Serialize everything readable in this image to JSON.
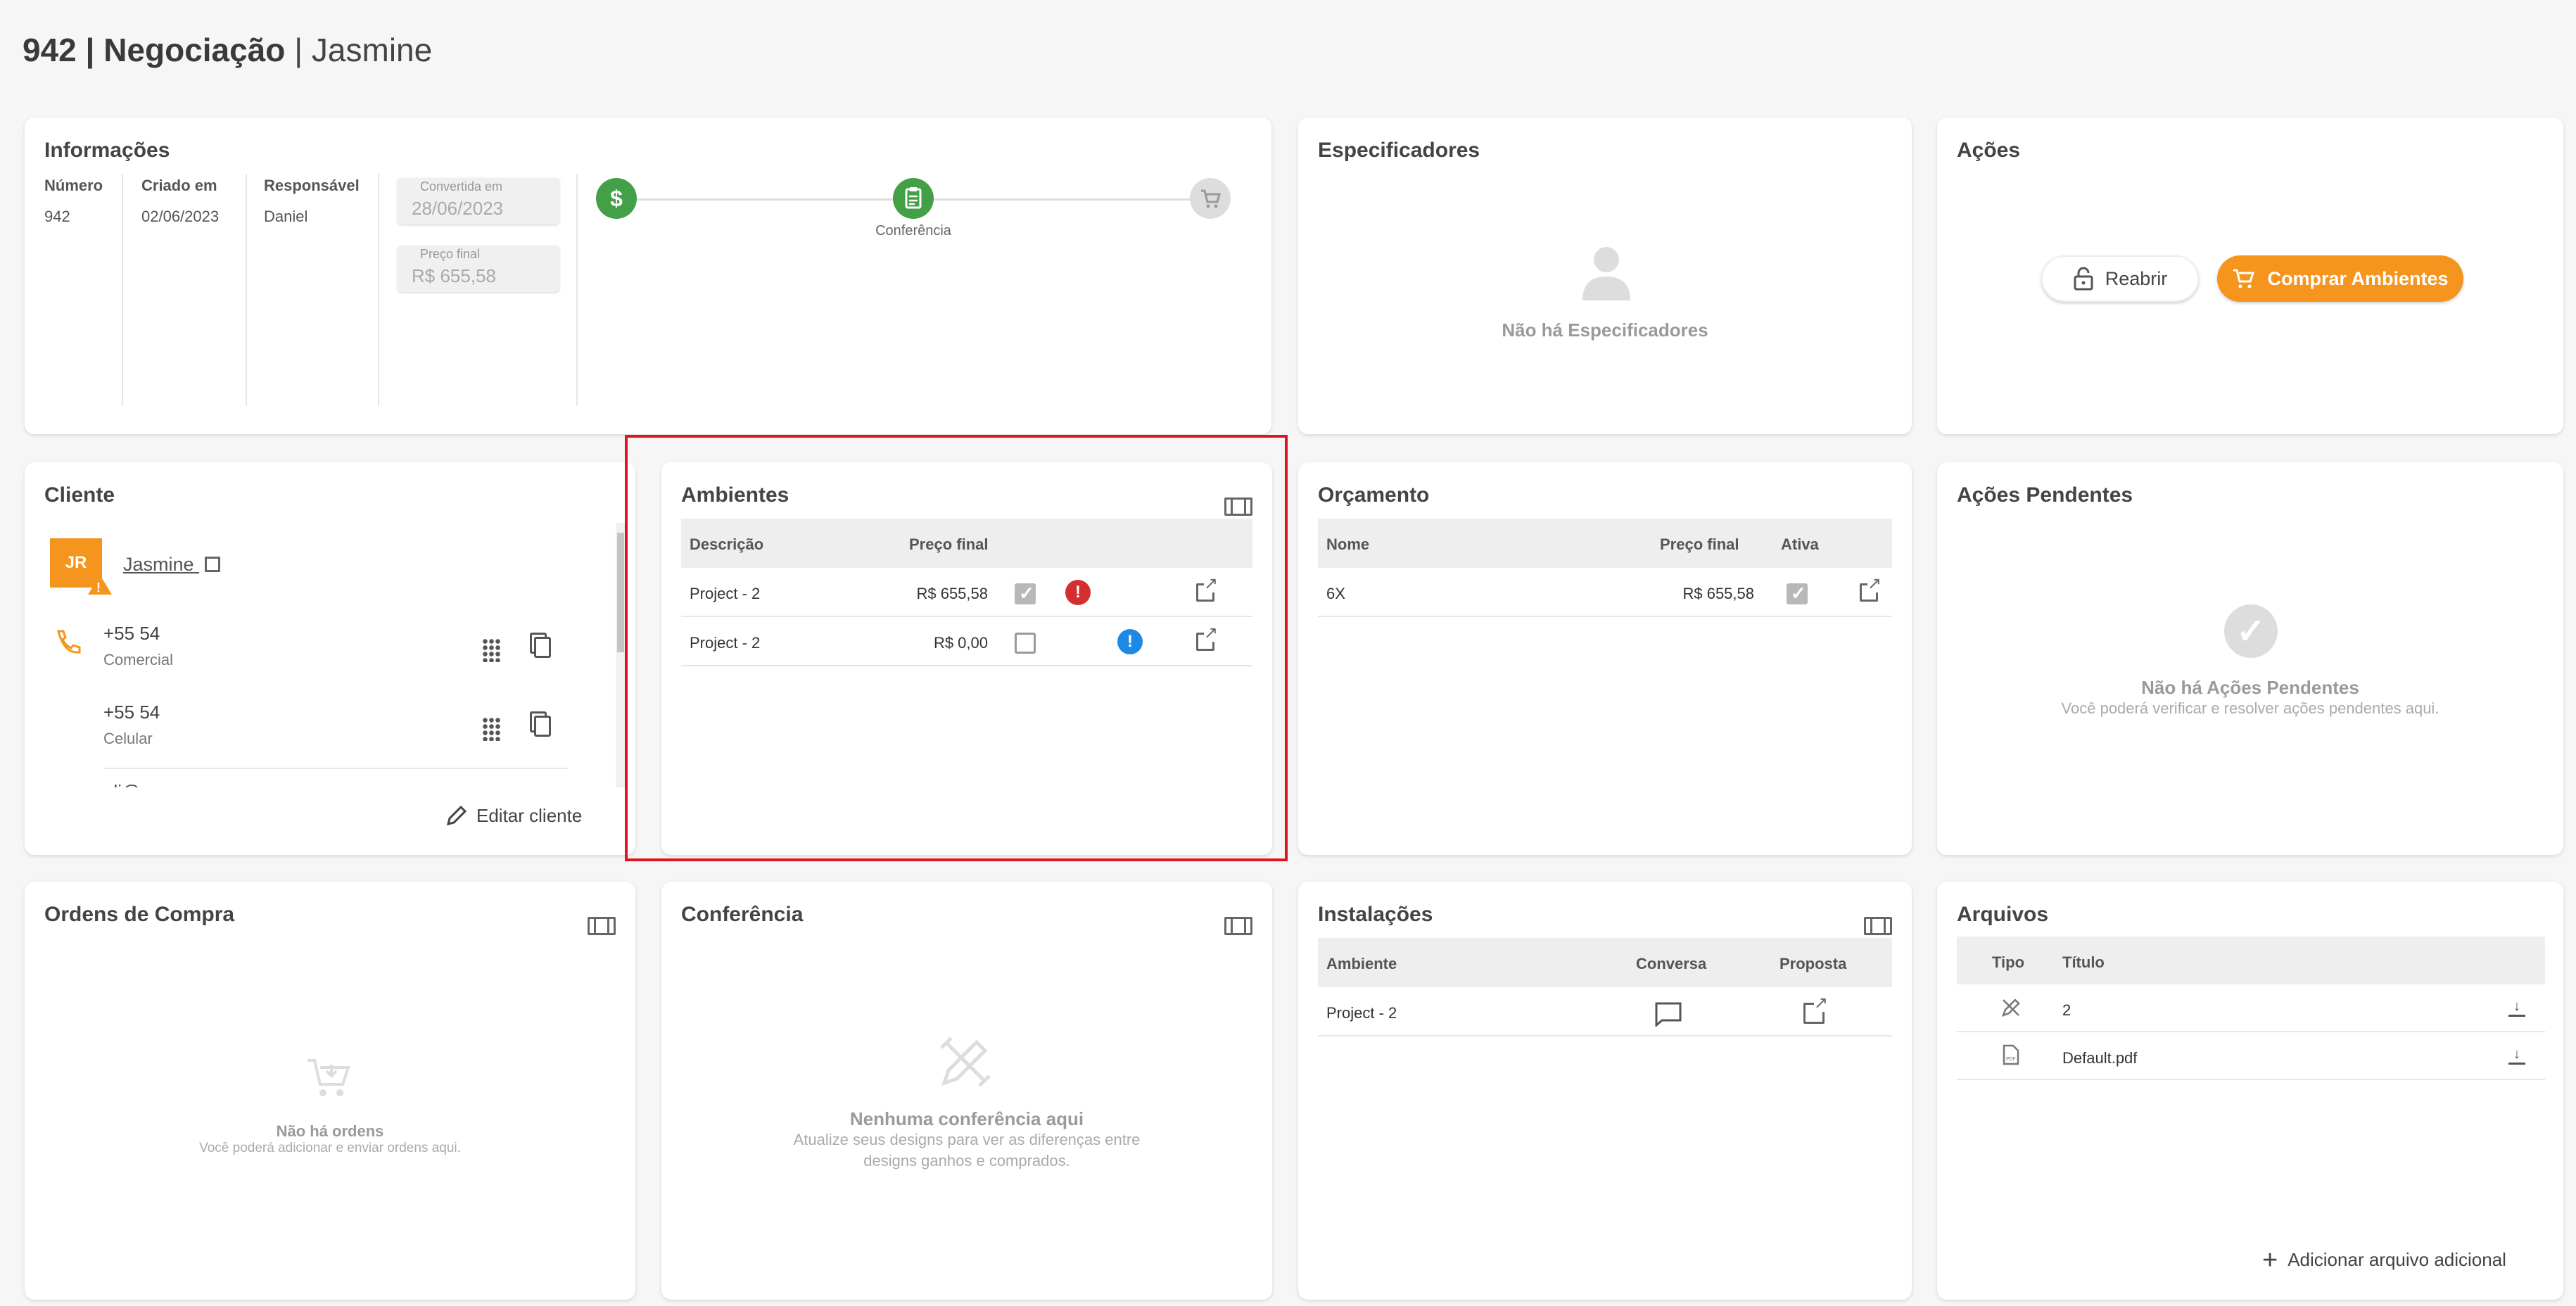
{
  "header": {
    "id": "942",
    "section": "Negociação",
    "client_name": "Jasmine",
    "sep": "|"
  },
  "informacoes": {
    "title": "Informações",
    "numero_label": "Número",
    "numero_value": "942",
    "criado_label": "Criado em",
    "criado_value": "02/06/2023",
    "responsavel_label": "Responsável",
    "responsavel_value": "Daniel",
    "convertida_label": "Convertida em",
    "convertida_value": "28/06/2023",
    "preco_label": "Preço final",
    "preco_value": "R$ 655,58",
    "stepper_current_label": "Conferência",
    "colors": {
      "step_active": "#43a047",
      "step_inactive": "#d6d6d6"
    },
    "icons": [
      "dollar-icon",
      "clipboard-icon",
      "cart-icon"
    ]
  },
  "especificadores": {
    "title": "Especificadores",
    "empty": "Não há Especificadores"
  },
  "acoes": {
    "title": "Ações",
    "reabrir": "Reabrir",
    "comprar": "Comprar Ambientes",
    "accent": "#f5951d"
  },
  "cliente": {
    "title": "Cliente",
    "initials": "JR",
    "name": "Jasmine",
    "phones": [
      {
        "number": "+55 54",
        "type": "Comercial"
      },
      {
        "number": "+55 54",
        "type": "Celular"
      }
    ],
    "email_partial": "nli@",
    "edit": "Editar cliente"
  },
  "ambientes": {
    "title": "Ambientes",
    "headers": [
      "Descrição",
      "Preço final"
    ],
    "rows": [
      {
        "desc": "Project - 2",
        "price": "R$ 655,58",
        "checked": true,
        "status": "error"
      },
      {
        "desc": "Project - 2",
        "price": "R$ 0,00",
        "checked": false,
        "status": "info"
      }
    ],
    "status_colors": {
      "error": "#d32f2f",
      "info": "#1e88e5"
    }
  },
  "orcamento": {
    "title": "Orçamento",
    "headers": [
      "Nome",
      "Preço final",
      "Ativa"
    ],
    "rows": [
      {
        "nome": "6X",
        "price": "R$ 655,58",
        "ativa": true
      }
    ]
  },
  "acoes_pendentes": {
    "title": "Ações Pendentes",
    "empty_title": "Não há Ações Pendentes",
    "empty_sub": "Você poderá verificar e resolver ações pendentes aqui."
  },
  "ordens": {
    "title": "Ordens de Compra",
    "empty_title": "Não há ordens",
    "empty_sub": "Você poderá adicionar e enviar ordens aqui."
  },
  "conferencia": {
    "title": "Conferência",
    "empty_title": "Nenhuma conferência aqui",
    "empty_sub1": "Atualize seus designs para ver as diferenças entre",
    "empty_sub2": "designs ganhos e comprados."
  },
  "instalacoes": {
    "title": "Instalações",
    "headers": [
      "Ambiente",
      "Conversa",
      "Proposta"
    ],
    "rows": [
      {
        "ambiente": "Project - 2"
      }
    ]
  },
  "arquivos": {
    "title": "Arquivos",
    "headers": [
      "Tipo",
      "Título"
    ],
    "rows": [
      {
        "titulo": "2",
        "icon": "design-icon"
      },
      {
        "titulo": "Default.pdf",
        "icon": "pdf-icon"
      }
    ],
    "add": "Adicionar arquivo adicional"
  },
  "highlight_color": "#e0141e"
}
